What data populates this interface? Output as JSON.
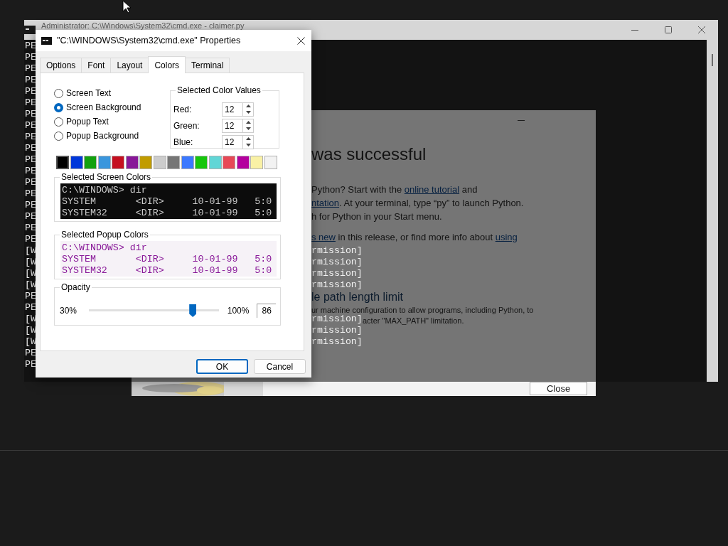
{
  "cmd_window": {
    "title": "Administrator: C:\\Windows\\System32\\cmd.exe - claimer.py",
    "lines": [
      {
        "left": "PE"
      },
      {
        "left": "PE"
      },
      {
        "left": "PE"
      },
      {
        "left": "PE"
      },
      {
        "left": "PE"
      },
      {
        "left": "PE"
      },
      {
        "left": "PE"
      },
      {
        "left": "PE"
      },
      {
        "left": "PE"
      },
      {
        "left": "PE"
      },
      {
        "left": "PE"
      },
      {
        "left": "PE"
      },
      {
        "left": "PE"
      },
      {
        "left": "PE"
      },
      {
        "left": "PE"
      },
      {
        "left": "PE"
      },
      {
        "left": "PE"
      },
      {
        "left": "PE"
      },
      {
        "left": "[W",
        "right": "rmission]"
      },
      {
        "left": "[W",
        "right": "rmission]"
      },
      {
        "left": "[W",
        "right": "rmission]"
      },
      {
        "left": "[W",
        "right": "rmission]"
      },
      {
        "left": "PE"
      },
      {
        "left": "PE"
      },
      {
        "left": "[W",
        "right": "rmission]"
      },
      {
        "left": "[W",
        "right": "rmission]"
      },
      {
        "left": "[W",
        "right": "rmission]"
      },
      {
        "left": "PE"
      },
      {
        "left": "PE"
      }
    ]
  },
  "installer": {
    "heading": "was successful",
    "paragraphs": [
      {
        "lines": [
          [
            {
              "text": "Python? Start with the "
            },
            {
              "text": "online tutorial",
              "link": true
            },
            {
              "text": " and"
            }
          ],
          [
            {
              "text": "ntation",
              "link": true
            },
            {
              "text": ". At your terminal, type “py” to launch Python."
            }
          ],
          [
            {
              "text": "h for Python in your Start menu."
            }
          ]
        ]
      },
      {
        "lines": [
          [
            {
              "text": "s new",
              "link": true
            },
            {
              "text": " in this release, or find more info about "
            },
            {
              "text": "using",
              "link": true
            }
          ]
        ]
      }
    ],
    "section_heading": "le path length limit",
    "section_lines": [
      {
        "text": "ur machine configuration to allow programs, including Python, to",
        "covered": false
      },
      {
        "text": "acter \"MAX_PATH\" limitation.",
        "covered": true
      }
    ],
    "close_button": "Close"
  },
  "dialog": {
    "title": "\"C:\\WINDOWS\\System32\\cmd.exe\" Properties",
    "tabs": [
      {
        "label": "Options",
        "selected": false
      },
      {
        "label": "Font",
        "selected": false
      },
      {
        "label": "Layout",
        "selected": false
      },
      {
        "label": "Colors",
        "selected": true
      },
      {
        "label": "Terminal",
        "selected": false
      }
    ],
    "radios": [
      {
        "label": "Screen Text",
        "selected": false
      },
      {
        "label": "Screen Background",
        "selected": true
      },
      {
        "label": "Popup Text",
        "selected": false
      },
      {
        "label": "Popup Background",
        "selected": false
      }
    ],
    "color_values": {
      "title": "Selected Color Values",
      "fields": [
        {
          "label": "Red:",
          "value": "12"
        },
        {
          "label": "Green:",
          "value": "12"
        },
        {
          "label": "Blue:",
          "value": "12"
        }
      ]
    },
    "swatches": [
      {
        "color": "#000000",
        "selected": true
      },
      {
        "color": "#0037da",
        "selected": false
      },
      {
        "color": "#13a10e",
        "selected": false
      },
      {
        "color": "#3a96dd",
        "selected": false
      },
      {
        "color": "#c50f1f",
        "selected": false
      },
      {
        "color": "#881798",
        "selected": false
      },
      {
        "color": "#c19c00",
        "selected": false
      },
      {
        "color": "#cccccc",
        "selected": false
      },
      {
        "color": "#767676",
        "selected": false
      },
      {
        "color": "#3b78ff",
        "selected": false
      },
      {
        "color": "#16c60c",
        "selected": false
      },
      {
        "color": "#61d6d6",
        "selected": false
      },
      {
        "color": "#e74856",
        "selected": false
      },
      {
        "color": "#b4009e",
        "selected": false
      },
      {
        "color": "#f9f1a5",
        "selected": false
      },
      {
        "color": "#f2f2f2",
        "selected": false
      }
    ],
    "screen_preview": {
      "title": "Selected Screen Colors",
      "lines": [
        "C:\\WINDOWS> dir",
        "SYSTEM       <DIR>     10-01-99   5:0",
        "SYSTEM32     <DIR>     10-01-99   5:0"
      ]
    },
    "popup_preview": {
      "title": "Selected Popup Colors",
      "lines": [
        "C:\\WINDOWS> dir",
        "SYSTEM       <DIR>     10-01-99   5:0",
        "SYSTEM32     <DIR>     10-01-99   5:0"
      ]
    },
    "opacity": {
      "title": "Opacity",
      "min_label": "30%",
      "max_label": "100%",
      "level": 0.8,
      "value": "86"
    },
    "buttons": [
      {
        "label": "OK",
        "kind": "default"
      },
      {
        "label": "Cancel",
        "kind": "normal"
      }
    ]
  }
}
